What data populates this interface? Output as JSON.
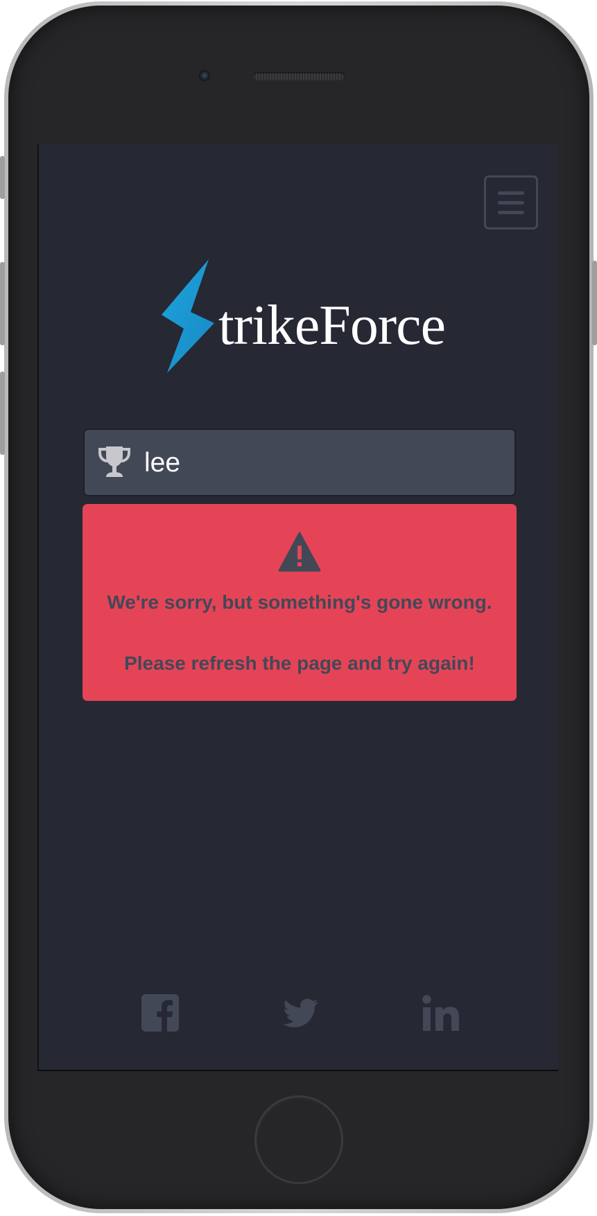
{
  "app": {
    "name_suffix": "trikeForce"
  },
  "search": {
    "value": "lee"
  },
  "error": {
    "line1": "We're sorry, but something's gone wrong.",
    "line2": "Please refresh the page and try again!"
  },
  "social": {
    "items": [
      {
        "name": "facebook",
        "icon": "facebook-icon"
      },
      {
        "name": "twitter",
        "icon": "twitter-icon"
      },
      {
        "name": "linkedin",
        "icon": "linkedin-icon"
      }
    ]
  },
  "colors": {
    "background": "#262833",
    "accent": "#1a9ad6",
    "error": "#e54457",
    "muted": "#434857",
    "text": "#ffffff"
  }
}
